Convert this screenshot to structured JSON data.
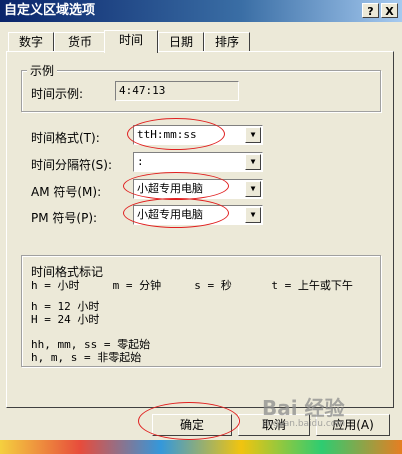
{
  "window": {
    "title": "自定义区域选项",
    "help_label": "?",
    "close_label": "X"
  },
  "tabs": [
    {
      "label": "数字"
    },
    {
      "label": "货币"
    },
    {
      "label": "时间"
    },
    {
      "label": "日期"
    },
    {
      "label": "排序"
    }
  ],
  "active_tab": "时间",
  "sample": {
    "group_label": "示例",
    "label": "时间示例:",
    "value": "4:47:13"
  },
  "format": {
    "label": "时间格式(T):",
    "value": "ttH:mm:ss"
  },
  "separator": {
    "label": "时间分隔符(S):",
    "value": ":"
  },
  "am": {
    "label": "AM 符号(M):",
    "value": "小超专用电脑"
  },
  "pm": {
    "label": "PM 符号(P):",
    "value": "小超专用电脑"
  },
  "legend_box": {
    "title": "时间格式标记",
    "line1": "h = 小时     m = 分钟     s = 秒      t = 上午或下午",
    "line2": "h = 12 小时",
    "line3": "H = 24 小时",
    "line4": "hh, mm, ss = 零起始",
    "line5": "h, m, s = 非零起始"
  },
  "buttons": {
    "ok": "确定",
    "cancel": "取消",
    "apply": "应用(A)"
  },
  "watermark": {
    "brand": "Bai 经验",
    "url": "jingyan.baidu.com"
  },
  "colors": {
    "annotation": "#e02020",
    "title_bar": "#0a246a",
    "dialog_bg": "#ece9d8"
  }
}
